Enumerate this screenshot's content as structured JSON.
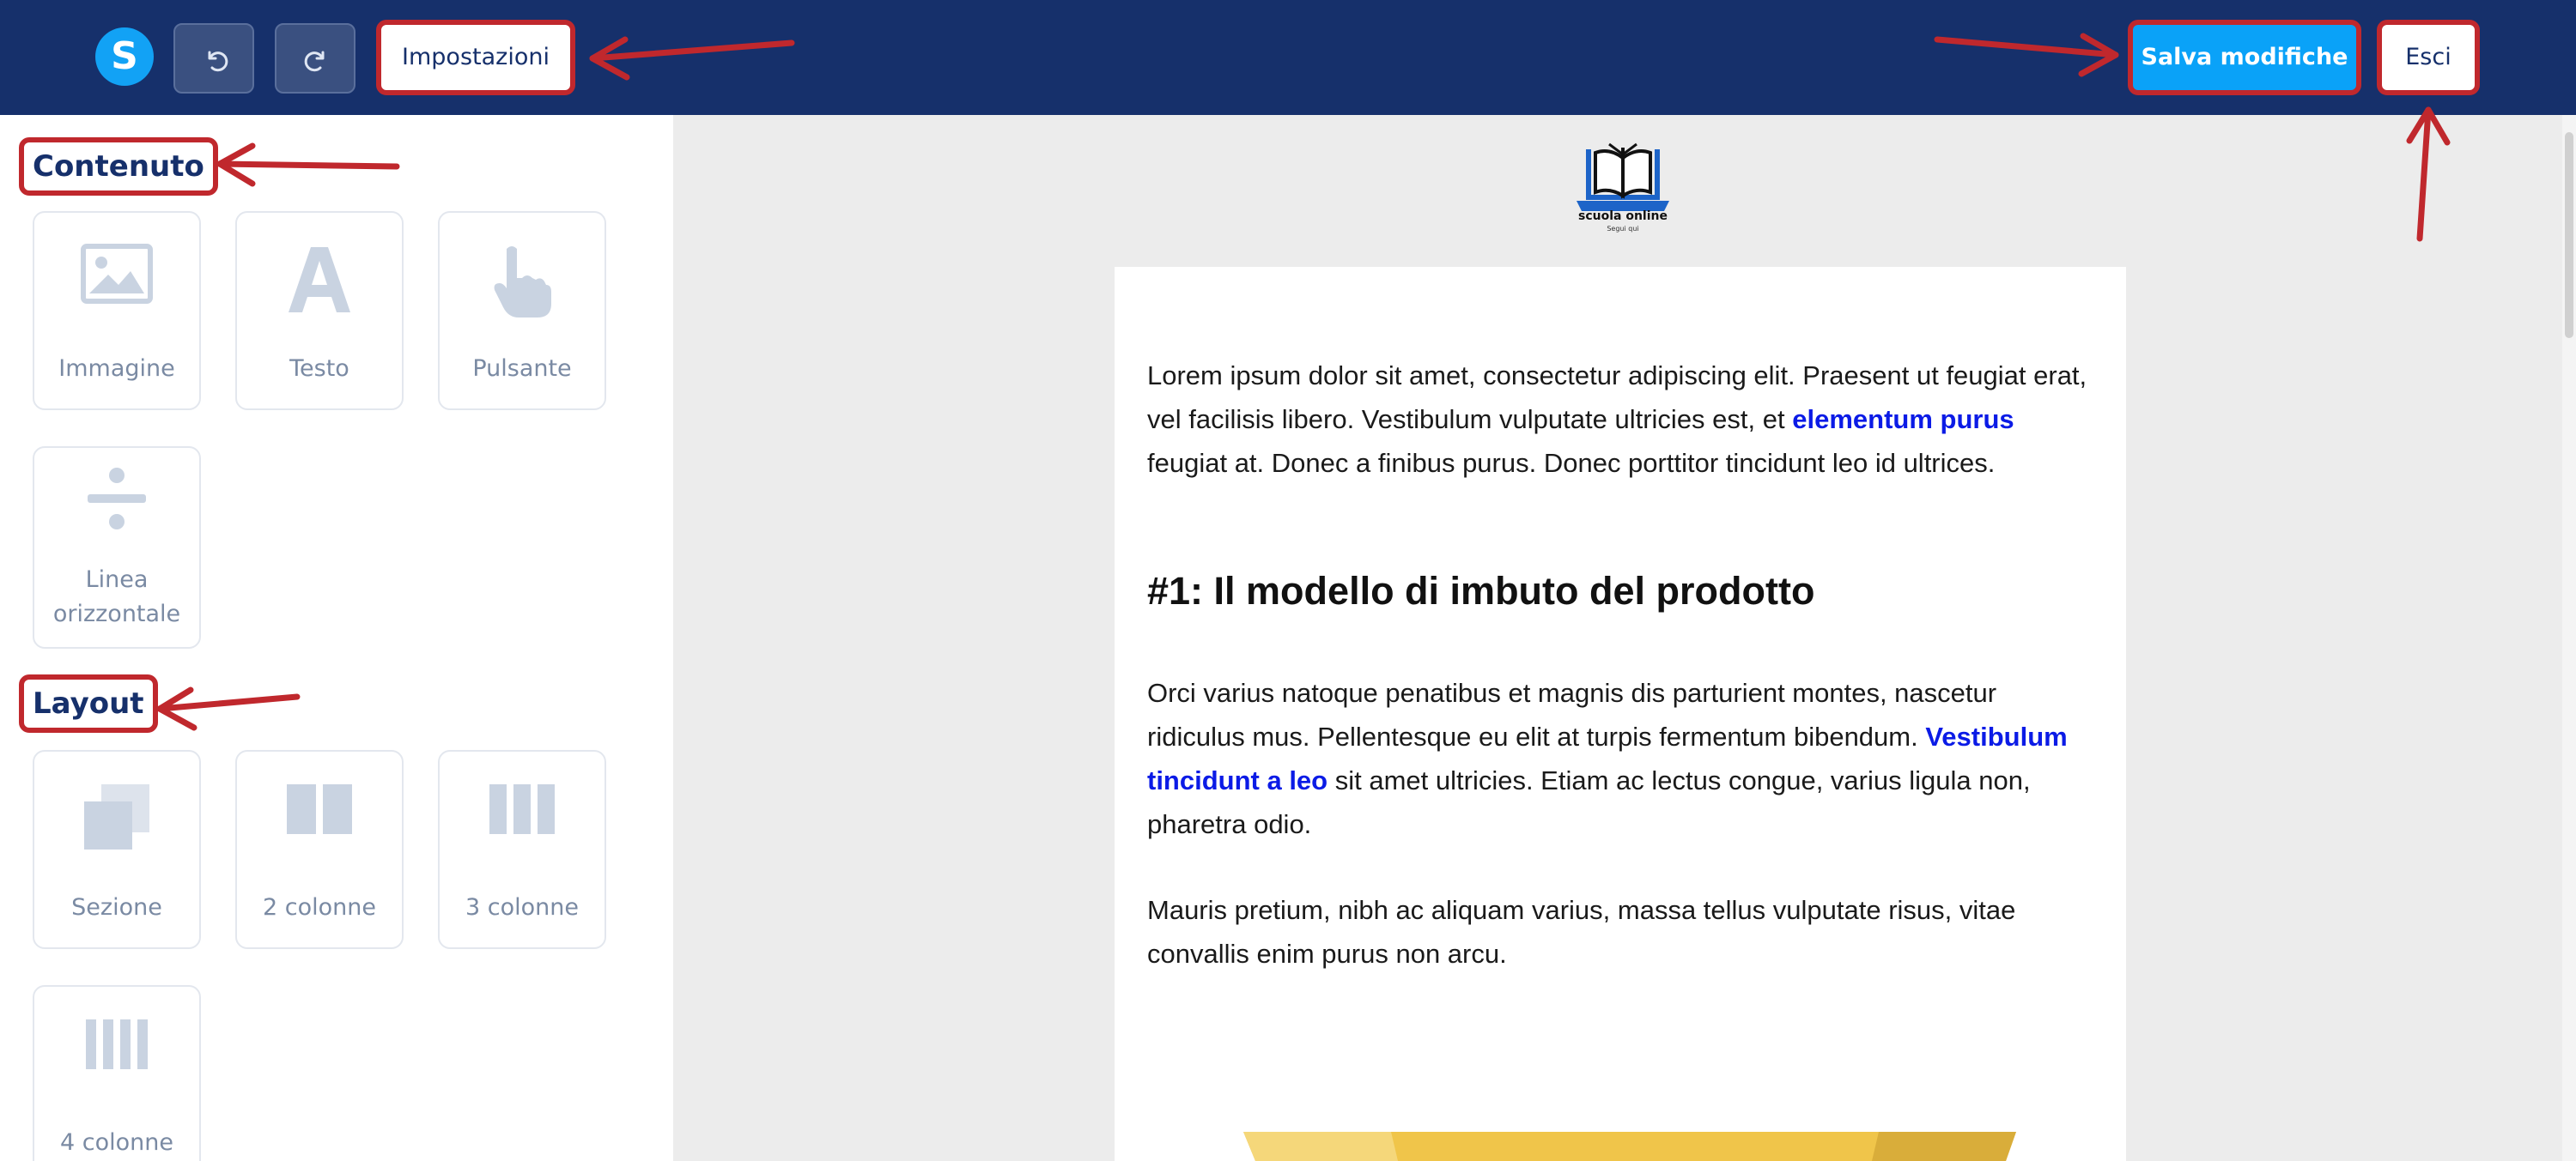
{
  "topbar": {
    "logo_letter": "S",
    "settings_label": "Impostazioni",
    "save_label": "Salva modifiche",
    "exit_label": "Esci"
  },
  "sidebar": {
    "content_title": "Contenuto",
    "layout_title": "Layout",
    "content_items": [
      {
        "label": "Immagine",
        "icon": "image-icon"
      },
      {
        "label": "Testo",
        "icon": "text-icon"
      },
      {
        "label": "Pulsante",
        "icon": "pointer-hand-icon"
      },
      {
        "label": "Linea orizzontale",
        "icon": "divide-icon"
      }
    ],
    "layout_items": [
      {
        "label": "Sezione",
        "icon": "section-icon"
      },
      {
        "label": "2 colonne",
        "icon": "two-columns-icon"
      },
      {
        "label": "3 colonne",
        "icon": "three-columns-icon"
      },
      {
        "label": "4 colonne",
        "icon": "four-columns-icon"
      }
    ]
  },
  "email": {
    "brand_name": "scuola online",
    "brand_tagline": "Segui qui",
    "p1_before": "Lorem ipsum dolor sit amet, consectetur adipiscing elit. Praesent ut feugiat erat, vel facilisis libero. Vestibulum vulputate ultricies est, et ",
    "p1_link": "elementum purus",
    "p1_after": " feugiat at. Donec a finibus purus. Donec porttitor tincidunt leo id ultrices.",
    "heading": "#1: Il modello di imbuto del prodotto",
    "p2_before": "Orci varius natoque penatibus et magnis dis parturient montes, nascetur ridiculus mus. Pellentesque eu elit at turpis fermentum bibendum. ",
    "p2_link": "Vestibulum tincidunt a leo",
    "p2_after": " sit amet ultricies. Etiam ac lectus congue, varius ligula non, pharetra odio.",
    "p3": "Mauris pretium, nibh ac aliquam varius, massa tellus vulputate risus, vitae convallis enim purus non arcu."
  },
  "colors": {
    "topbar": "#16306b",
    "accent": "#0aa2f8",
    "annotation": "#c0282d",
    "link": "#0b1be6",
    "funnel": "#f0c54a"
  }
}
